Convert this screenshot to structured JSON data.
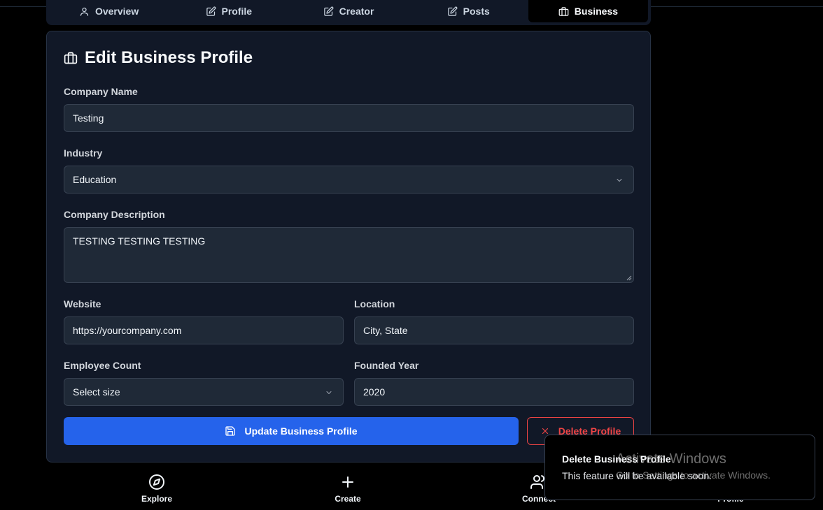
{
  "tabs": [
    {
      "label": "Overview",
      "icon": "user-icon"
    },
    {
      "label": "Profile",
      "icon": "edit-icon"
    },
    {
      "label": "Creator",
      "icon": "edit-icon"
    },
    {
      "label": "Posts",
      "icon": "edit-icon"
    },
    {
      "label": "Business",
      "icon": "briefcase-icon",
      "active": true
    }
  ],
  "card": {
    "title": "Edit Business Profile",
    "company_name": {
      "label": "Company Name",
      "value": "Testing"
    },
    "industry": {
      "label": "Industry",
      "value": "Education"
    },
    "description": {
      "label": "Company Description",
      "value": "TESTING TESTING TESTING"
    },
    "website": {
      "label": "Website",
      "placeholder": "https://yourcompany.com"
    },
    "location": {
      "label": "Location",
      "placeholder": "City, State"
    },
    "employee_count": {
      "label": "Employee Count",
      "value": "Select size"
    },
    "founded_year": {
      "label": "Founded Year",
      "value": "2020"
    },
    "update_button": "Update Business Profile",
    "delete_button": "Delete Profile"
  },
  "bottom_nav": [
    {
      "label": "Explore",
      "icon": "compass-icon"
    },
    {
      "label": "Create",
      "icon": "plus-icon"
    },
    {
      "label": "Connect",
      "icon": "users-icon"
    },
    {
      "label": "Profile",
      "icon": "user-icon"
    }
  ],
  "toast": {
    "title": "Delete Business Profile",
    "message": "This feature will be available soon."
  },
  "watermark": {
    "title": "Activate Windows",
    "subtitle": "Go to Settings to activate Windows."
  },
  "colors": {
    "background": "#000000",
    "card": "#111827",
    "field": "#1f2937",
    "primary": "#2563eb",
    "danger": "#ef4444"
  }
}
